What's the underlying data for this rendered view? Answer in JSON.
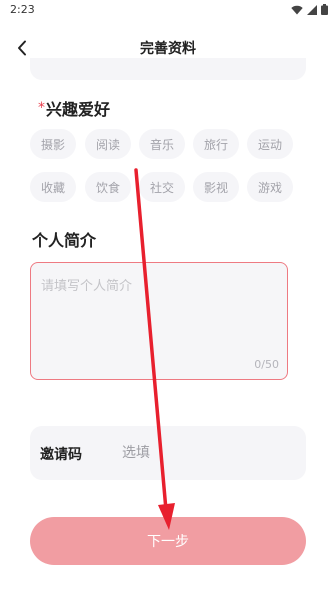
{
  "status_bar": {
    "time": "2:23"
  },
  "header": {
    "title": "完善资料"
  },
  "interests": {
    "required_mark": "*",
    "title": "兴趣爱好",
    "tags": [
      "摄影",
      "阅读",
      "音乐",
      "旅行",
      "运动",
      "收藏",
      "饮食",
      "社交",
      "影视",
      "游戏"
    ]
  },
  "bio": {
    "title": "个人简介",
    "placeholder": "请填写个人简介",
    "counter": "0/50"
  },
  "invite_code": {
    "label": "邀请码",
    "placeholder": "选填"
  },
  "next_button": {
    "label": "下一步"
  },
  "colors": {
    "accent": "#f19da2",
    "bio_border": "#ee7a82",
    "required": "#e8404e",
    "annotation_arrow": "#e8202e"
  }
}
